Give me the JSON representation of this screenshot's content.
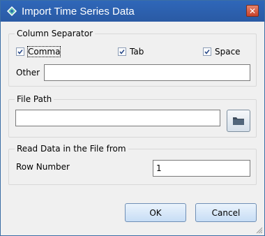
{
  "window": {
    "title": "Import Time Series Data",
    "close_label": "✕"
  },
  "separator": {
    "legend": "Column Separator",
    "comma_label": "Comma",
    "comma_checked": true,
    "tab_label": "Tab",
    "tab_checked": true,
    "space_label": "Space",
    "space_checked": true,
    "other_label": "Other",
    "other_value": ""
  },
  "file": {
    "legend": "File Path",
    "path_value": ""
  },
  "read": {
    "legend": "Read Data in the File from",
    "row_label": "Row Number",
    "row_value": "1"
  },
  "buttons": {
    "ok_label": "OK",
    "cancel_label": "Cancel"
  },
  "colors": {
    "titlebar": "#2f67b9",
    "close": "#c8412a",
    "button": "#c7ddf5"
  }
}
